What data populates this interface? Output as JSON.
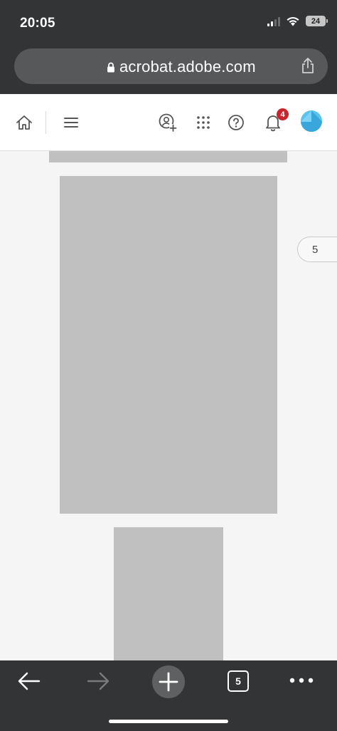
{
  "status_bar": {
    "time": "20:05",
    "battery": "24",
    "icons": [
      "cellular-signal-icon",
      "wifi-icon",
      "battery-icon"
    ]
  },
  "browser": {
    "url": "acrobat.adobe.com",
    "icons": [
      "lock-icon",
      "share-icon"
    ],
    "bottom_bar": {
      "tab_count": "5",
      "icons": [
        "back-arrow-icon",
        "forward-arrow-icon",
        "plus-icon",
        "tabs-icon",
        "more-dots-icon"
      ]
    }
  },
  "app_toolbar": {
    "icons": [
      "home-icon",
      "hamburger-menu-icon",
      "add-user-icon",
      "app-grid-icon",
      "help-icon",
      "bell-icon",
      "avatar"
    ],
    "notification_count": "4"
  },
  "document": {
    "page_number": "5"
  },
  "colors": {
    "chrome": "#333435",
    "url_bar": "#575859",
    "page_placeholder": "#c0c0c0",
    "notification_badge": "#c9252c",
    "avatar": "#5ac2ee"
  }
}
